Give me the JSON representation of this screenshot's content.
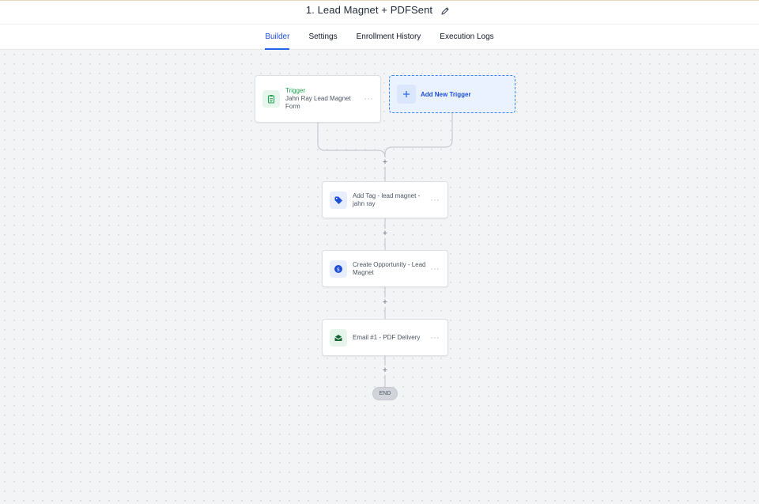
{
  "header": {
    "title": "1. Lead Magnet + PDFSent"
  },
  "tabs": [
    {
      "label": "Builder",
      "active": true
    },
    {
      "label": "Settings",
      "active": false
    },
    {
      "label": "Enrollment History",
      "active": false
    },
    {
      "label": "Execution Logs",
      "active": false
    }
  ],
  "trigger": {
    "label": "Trigger",
    "text": "Jahn Ray Lead Magnet Form",
    "icon": "clipboard-icon"
  },
  "add_trigger": {
    "label": "Add New Trigger"
  },
  "actions": [
    {
      "text": "Add Tag - lead magnet - jahn ray",
      "icon": "tag-icon"
    },
    {
      "text": "Create Opportunity - Lead Magnet",
      "icon": "dollar-icon"
    },
    {
      "text": "Email #1 - PDF Delivery",
      "icon": "envelope-icon"
    }
  ],
  "menu_glyph": "···",
  "plus_glyph": "+",
  "end_label": "END",
  "colors": {
    "accent": "#2563eb",
    "trigger_green": "#16a34a",
    "canvas": "#f3f4f6"
  }
}
